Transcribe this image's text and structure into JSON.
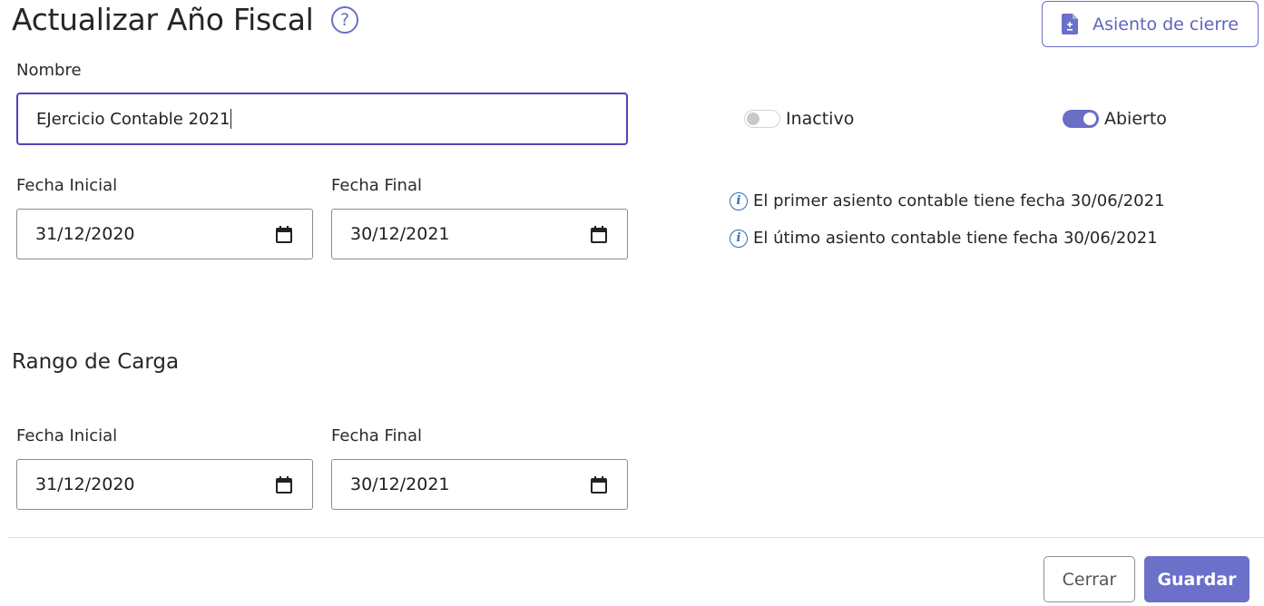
{
  "header": {
    "title": "Actualizar Año Fiscal",
    "help_icon": "question-circle-icon",
    "help_glyph": "?",
    "closing_button_label": "Asiento de cierre",
    "closing_button_icon": "document-plus-minus-icon"
  },
  "form": {
    "name_label": "Nombre",
    "name_value": "EJercicio Contable 2021",
    "inactive_toggle": {
      "label": "Inactivo",
      "checked": false
    },
    "open_toggle": {
      "label": "Abierto",
      "checked": true
    },
    "fiscal_period": {
      "start_label": "Fecha Inicial",
      "start_value": "31/12/2020",
      "end_label": "Fecha Final",
      "end_value": "30/12/2021"
    },
    "info": {
      "icon": "info-circle-icon",
      "glyph": "i",
      "first_entry": "El primer asiento contable tiene fecha 30/06/2021",
      "last_entry": "El útimo asiento contable tiene fecha 30/06/2021"
    },
    "load_range": {
      "title": "Rango de Carga",
      "start_label": "Fecha Inicial",
      "start_value": "31/12/2020",
      "end_label": "Fecha Final",
      "end_value": "30/12/2021"
    }
  },
  "footer": {
    "close_label": "Cerrar",
    "save_label": "Guardar"
  },
  "colors": {
    "accent": "#6b70c9",
    "focus_border": "#5a3fb5",
    "info_blue": "#2d6fb6"
  }
}
